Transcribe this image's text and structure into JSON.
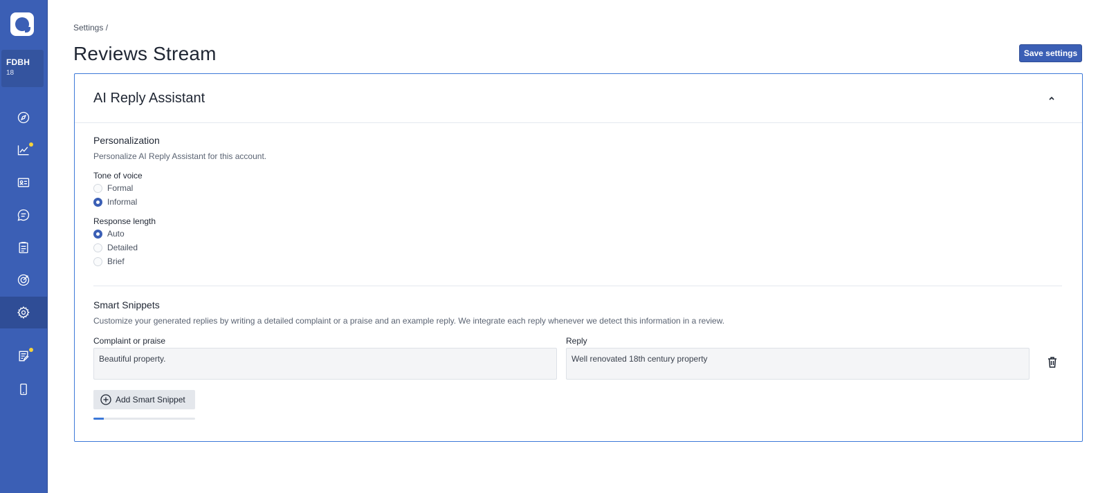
{
  "sidebar": {
    "account_name": "FDBH",
    "account_number": "18",
    "items": [
      {
        "icon": "compass-icon"
      },
      {
        "icon": "trending-up-icon",
        "badge": true
      },
      {
        "icon": "contact-card-icon"
      },
      {
        "icon": "chat-icon"
      },
      {
        "icon": "clipboard-icon"
      },
      {
        "icon": "target-icon"
      },
      {
        "icon": "gear-icon",
        "active": true
      },
      {
        "icon": "note-edit-icon",
        "badge": true
      },
      {
        "icon": "mobile-icon"
      }
    ]
  },
  "header": {
    "breadcrumb": "Settings  /",
    "title": "Reviews Stream",
    "save_label": "Save settings"
  },
  "card": {
    "title": "AI Reply Assistant",
    "personalization": {
      "title": "Personalization",
      "description": "Personalize AI Reply Assistant for this account.",
      "tone_label": "Tone of voice",
      "tone_options": [
        "Formal",
        "Informal"
      ],
      "tone_selected": "Informal",
      "length_label": "Response length",
      "length_options": [
        "Auto",
        "Detailed",
        "Brief"
      ],
      "length_selected": "Auto"
    },
    "snippets": {
      "title": "Smart Snippets",
      "description": "Customize your generated replies by writing a detailed complaint or a praise and an example reply. We integrate each reply whenever we detect this information in a review.",
      "complaint_label": "Complaint or praise",
      "reply_label": "Reply",
      "complaint_value": "Beautiful property.",
      "reply_value": "Well renovated 18th century property",
      "add_label": "Add Smart Snippet",
      "progress_fraction": 0.1
    }
  },
  "colors": {
    "sidebar": "#3b5fb5",
    "accent": "#3b78d8",
    "badge": "#f5d23b"
  }
}
